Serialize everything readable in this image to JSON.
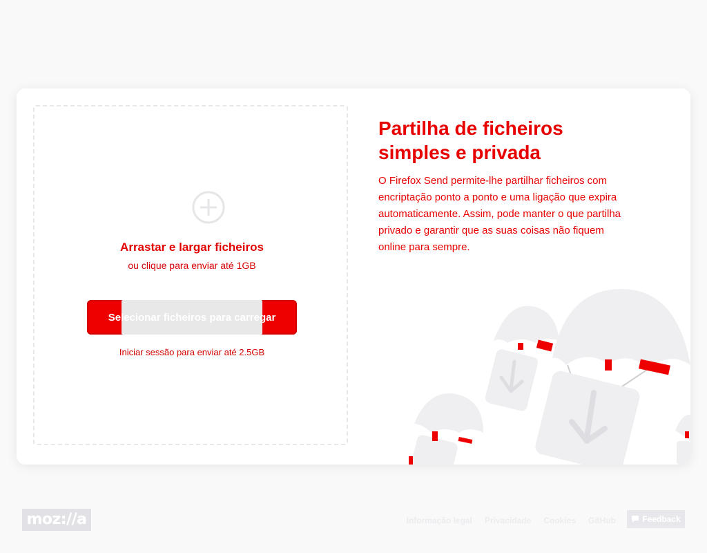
{
  "upload": {
    "drop_title": "Arrastar e largar ficheiros",
    "drop_subtitle": "ou clique para enviar até 1GB",
    "select_button": "Selecionar ficheiros para carregar",
    "signin_hint": "Iniciar sessão para enviar até 2.5GB"
  },
  "promo": {
    "title": "Partilha de ficheiros simples e privada",
    "body": "O Firefox Send permite-lhe partilhar ficheiros com encriptação ponto a ponto e uma ligação que expira automaticamente. Assim, pode manter o que partilha privado e garantir que as suas coisas não fiquem online para sempre."
  },
  "footer": {
    "logo": "moz://a",
    "links": [
      "Informação legal",
      "Privacidade",
      "Cookies",
      "GitHub"
    ],
    "feedback": "Feedback"
  },
  "colors": {
    "accent": "#ee0000",
    "page_bg": "#f9f9fa",
    "muted": "#ececef"
  }
}
